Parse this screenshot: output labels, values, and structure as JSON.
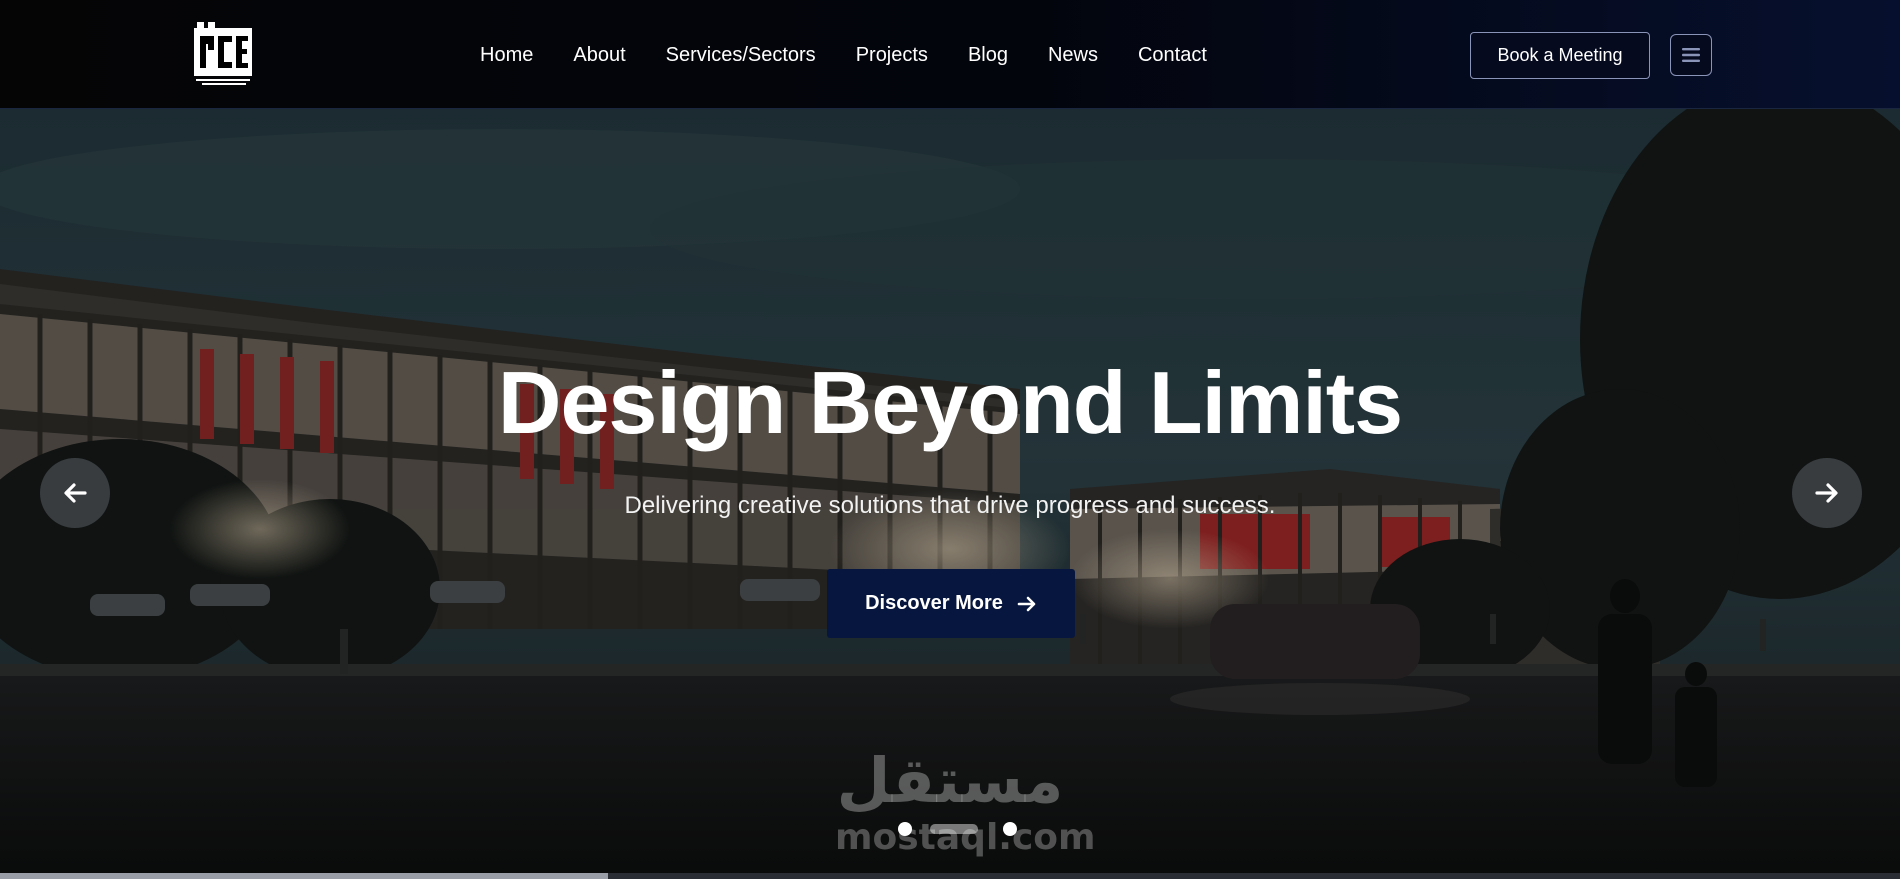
{
  "header": {
    "logo": {
      "text": "PCE",
      "icon": "pce-logo"
    },
    "nav": [
      {
        "label": "Home"
      },
      {
        "label": "About"
      },
      {
        "label": "Services/Sectors"
      },
      {
        "label": "Projects"
      },
      {
        "label": "Blog"
      },
      {
        "label": "News"
      },
      {
        "label": "Contact"
      }
    ],
    "book_button": "Book a Meeting",
    "menu_icon": "hamburger-icon"
  },
  "hero": {
    "title": "Design Beyond Limits",
    "subtitle": "Delivering creative solutions that drive progress and success.",
    "cta_label": "Discover More",
    "cta_icon": "arrow-right-icon",
    "prev_icon": "arrow-left-icon",
    "next_icon": "arrow-right-icon",
    "slides": {
      "count": 3,
      "active": 2
    },
    "progress": 0.32
  },
  "watermark": {
    "arabic": "مستقل",
    "latin": "mostaql.com"
  },
  "colors": {
    "nav_bg": "#03050d",
    "button_dark_blue": "#07163f",
    "button_border": "#8a93b8",
    "text": "#ffffff"
  }
}
